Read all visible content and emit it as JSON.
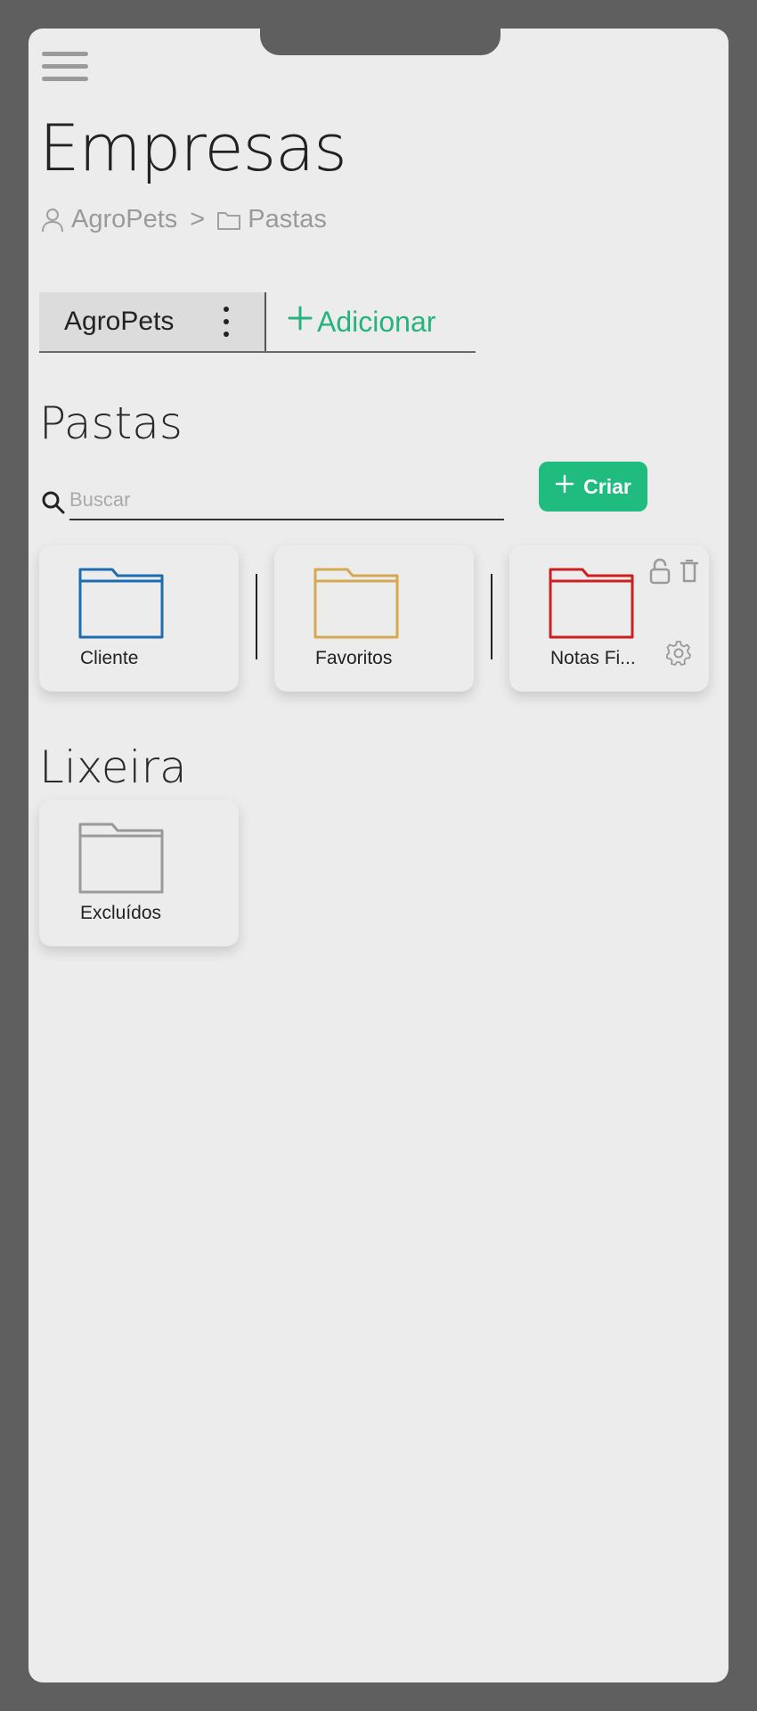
{
  "page": {
    "title": "Empresas"
  },
  "breadcrumb": {
    "company": "AgroPets",
    "separator": ">",
    "folder": "Pastas"
  },
  "tabs": {
    "active_label": "AgroPets",
    "add_label": "Adicionar",
    "add_icon": "plus-icon"
  },
  "folders_section": {
    "title": "Pastas",
    "search_placeholder": "Buscar",
    "search_value": "",
    "create_label": "Criar"
  },
  "folders": [
    {
      "label": "Cliente",
      "color": "#1d6bb0"
    },
    {
      "label": "Favoritos",
      "color": "#d4a954"
    },
    {
      "label": "Notas Fi...",
      "color": "#cc1f1f",
      "actions": [
        "unlock-icon",
        "trash-icon",
        "gear-icon"
      ]
    }
  ],
  "trash_section": {
    "title": "Lixeira",
    "folders": [
      {
        "label": "Excluídos",
        "color": "#9a9a9a"
      }
    ]
  },
  "colors": {
    "accent": "#1fbb7f",
    "frame": "#5f5f5f",
    "surface": "#ececec"
  }
}
